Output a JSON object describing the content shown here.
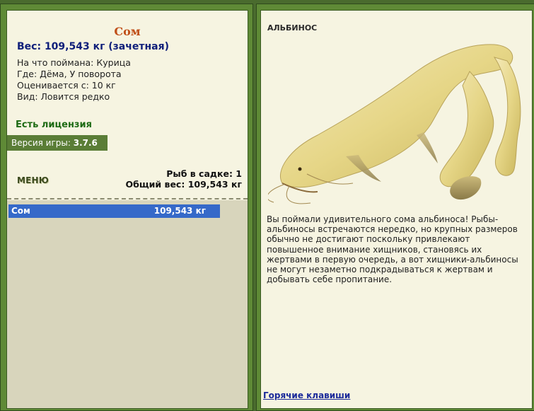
{
  "fish": {
    "name": "Сом",
    "weight_line": "Вес: 109,543 кг (зачетная)",
    "bait": "На что поймана: Курица",
    "location": "Где: Дёма, У поворота",
    "rated_from": "Оценивается с: 10 кг",
    "rarity": "Вид: Ловится редко"
  },
  "license": "Есть лицензия",
  "version": {
    "label": "Версия игры: ",
    "value": "3.7.6"
  },
  "menu_label": "МЕНЮ",
  "keepnet": {
    "count_line": "Рыб в садке: 1",
    "total_line": "Общий вес: 109,543 кг",
    "rows": [
      {
        "name": "Сом",
        "weight": "109,543 кг"
      }
    ]
  },
  "right_panel": {
    "badge": "АЛЬБИНОС",
    "description": "Вы поймали удивительного сома альбиноса! Рыбы-альбиносы встречаются нередко, но крупных размеров обычно не достигают поскольку привлекают повышенное внимание хищников, становясь их жертвами в первую очередь, а вот хищники-альбиносы не могут незаметно подкрадываться к жертвам и добывать себе пропитание.",
    "hotkeys_link": "Горячие клавиши"
  },
  "colors": {
    "frame_green": "#5f8a36",
    "panel_bg": "#f6f4e1",
    "title_orange": "#c0501a",
    "weight_blue": "#0f1f7a",
    "selected_row": "#3569c9"
  },
  "icons": {
    "fish_picture": "albino-catfish-image"
  }
}
